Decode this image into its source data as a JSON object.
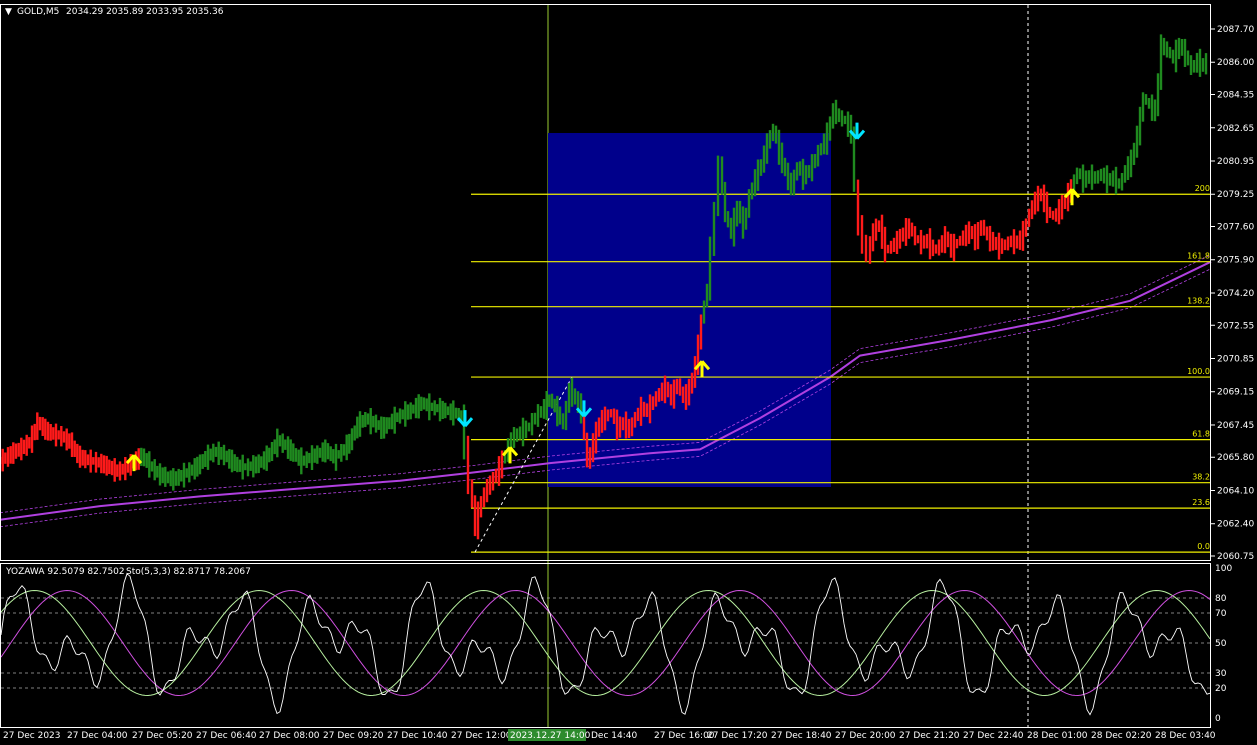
{
  "header": {
    "symbol": "GOLD,M5",
    "ohlc": "2034.29 2035.89 2033.95 2035.36"
  },
  "indicator_header": {
    "yozawa": "YOZAWA 92.5079 82.7502",
    "stoch": "Sto(5,3,3) 82.8717 78.2067"
  },
  "colors": {
    "background": "#000000",
    "bull": "#1f8a1f",
    "bear": "#ff1a1a",
    "fib_line": "#f0f000",
    "box": "#00008b",
    "ma": "#b040e0",
    "cursor_line": "#9acd32",
    "up_arrow": "#ffff00",
    "down_arrow": "#00e5ff"
  },
  "chart_data": {
    "type": "candlestick",
    "price_axis_labels": [
      "2087.70",
      "2086.00",
      "2084.35",
      "2082.65",
      "2080.95",
      "2079.25",
      "2077.60",
      "2075.90",
      "2074.20",
      "2072.55",
      "2070.85",
      "2069.15",
      "2067.45",
      "2065.80",
      "2064.10",
      "2062.40",
      "2060.75"
    ],
    "ylim": [
      2060.75,
      2087.7
    ],
    "time_axis_labels": [
      "27 Dec 2023",
      "27 Dec 04:00",
      "27 Dec 05:20",
      "27 Dec 06:40",
      "27 Dec 08:00",
      "27 Dec 09:20",
      "27 Dec 10:40",
      "27 Dec 12:00",
      "2023.12.27 14:00",
      "Dec 14:40",
      "27 Dec 16:00",
      "27 Dec 17:20",
      "27 Dec 18:40",
      "27 Dec 20:00",
      "27 Dec 21:20",
      "27 Dec 22:40",
      "28 Dec 01:00",
      "28 Dec 02:20",
      "28 Dec 03:40"
    ],
    "close_path": [
      [
        0,
        2065.6
      ],
      [
        8,
        2065.8
      ],
      [
        16,
        2066.1
      ],
      [
        24,
        2066.3
      ],
      [
        32,
        2066.6
      ],
      [
        40,
        2067.6
      ],
      [
        48,
        2067.2
      ],
      [
        56,
        2067.0
      ],
      [
        64,
        2066.9
      ],
      [
        72,
        2066.6
      ],
      [
        80,
        2065.9
      ],
      [
        88,
        2065.7
      ],
      [
        96,
        2065.6
      ],
      [
        104,
        2065.5
      ],
      [
        112,
        2065.3
      ],
      [
        120,
        2065.1
      ],
      [
        128,
        2065.3
      ],
      [
        136,
        2065.6
      ],
      [
        144,
        2065.9
      ],
      [
        152,
        2065.4
      ],
      [
        160,
        2065.0
      ],
      [
        168,
        2064.8
      ],
      [
        176,
        2064.7
      ],
      [
        184,
        2064.9
      ],
      [
        192,
        2065.1
      ],
      [
        200,
        2065.4
      ],
      [
        208,
        2065.8
      ],
      [
        216,
        2066.1
      ],
      [
        224,
        2066.0
      ],
      [
        232,
        2065.7
      ],
      [
        240,
        2065.4
      ],
      [
        248,
        2065.3
      ],
      [
        256,
        2065.4
      ],
      [
        264,
        2065.6
      ],
      [
        272,
        2066.0
      ],
      [
        280,
        2066.7
      ],
      [
        288,
        2066.4
      ],
      [
        296,
        2066.0
      ],
      [
        304,
        2065.6
      ],
      [
        312,
        2065.8
      ],
      [
        320,
        2066.0
      ],
      [
        328,
        2066.2
      ],
      [
        336,
        2065.8
      ],
      [
        344,
        2066.1
      ],
      [
        352,
        2066.6
      ],
      [
        360,
        2067.5
      ],
      [
        368,
        2067.8
      ],
      [
        376,
        2067.6
      ],
      [
        384,
        2067.3
      ],
      [
        392,
        2067.6
      ],
      [
        400,
        2067.9
      ],
      [
        408,
        2068.1
      ],
      [
        416,
        2068.3
      ],
      [
        424,
        2068.6
      ],
      [
        432,
        2068.4
      ],
      [
        440,
        2068.3
      ],
      [
        448,
        2068.2
      ],
      [
        456,
        2068.1
      ],
      [
        464,
        2067.9
      ],
      [
        468,
        2066.4
      ],
      [
        472,
        2064.5
      ],
      [
        478,
        2062.3
      ],
      [
        484,
        2063.6
      ],
      [
        490,
        2064.3
      ],
      [
        496,
        2064.7
      ],
      [
        502,
        2065.3
      ],
      [
        508,
        2066.0
      ],
      [
        514,
        2066.8
      ],
      [
        520,
        2067.0
      ],
      [
        526,
        2067.2
      ],
      [
        532,
        2067.4
      ],
      [
        538,
        2067.9
      ],
      [
        544,
        2068.2
      ],
      [
        552,
        2068.8
      ],
      [
        560,
        2068.1
      ],
      [
        566,
        2067.5
      ],
      [
        572,
        2069.3
      ],
      [
        578,
        2068.8
      ],
      [
        584,
        2068.2
      ],
      [
        590,
        2065.5
      ],
      [
        596,
        2066.6
      ],
      [
        602,
        2067.6
      ],
      [
        608,
        2067.9
      ],
      [
        614,
        2068.1
      ],
      [
        620,
        2067.3
      ],
      [
        626,
        2067.6
      ],
      [
        632,
        2067.2
      ],
      [
        638,
        2067.9
      ],
      [
        644,
        2068.3
      ],
      [
        650,
        2068.2
      ],
      [
        656,
        2068.7
      ],
      [
        662,
        2069.1
      ],
      [
        668,
        2069.4
      ],
      [
        674,
        2068.9
      ],
      [
        680,
        2069.6
      ],
      [
        686,
        2068.8
      ],
      [
        692,
        2069.3
      ],
      [
        698,
        2070.5
      ],
      [
        704,
        2072.8
      ],
      [
        710,
        2074.5
      ],
      [
        714,
        2076.5
      ],
      [
        718,
        2078.5
      ],
      [
        722,
        2080.9
      ],
      [
        728,
        2078.2
      ],
      [
        734,
        2077.3
      ],
      [
        740,
        2078.6
      ],
      [
        746,
        2077.6
      ],
      [
        752,
        2079.2
      ],
      [
        758,
        2080.1
      ],
      [
        764,
        2080.8
      ],
      [
        770,
        2081.9
      ],
      [
        776,
        2082.6
      ],
      [
        782,
        2081.4
      ],
      [
        788,
        2080.4
      ],
      [
        794,
        2079.6
      ],
      [
        800,
        2080.7
      ],
      [
        806,
        2080.2
      ],
      [
        812,
        2080.5
      ],
      [
        818,
        2081.1
      ],
      [
        824,
        2081.7
      ],
      [
        830,
        2082.3
      ],
      [
        836,
        2083.6
      ],
      [
        842,
        2083.2
      ],
      [
        848,
        2083.0
      ],
      [
        854,
        2082.5
      ],
      [
        858,
        2079.6
      ],
      [
        862,
        2077.6
      ],
      [
        866,
        2076.9
      ],
      [
        870,
        2076.1
      ],
      [
        876,
        2077.4
      ],
      [
        882,
        2077.7
      ],
      [
        888,
        2076.4
      ],
      [
        894,
        2076.6
      ],
      [
        900,
        2076.9
      ],
      [
        906,
        2077.3
      ],
      [
        912,
        2077.6
      ],
      [
        918,
        2077.0
      ],
      [
        924,
        2076.8
      ],
      [
        930,
        2076.9
      ],
      [
        936,
        2076.4
      ],
      [
        942,
        2076.6
      ],
      [
        948,
        2077.1
      ],
      [
        954,
        2076.5
      ],
      [
        960,
        2076.8
      ],
      [
        966,
        2077.1
      ],
      [
        972,
        2077.4
      ],
      [
        978,
        2077.0
      ],
      [
        984,
        2077.7
      ],
      [
        990,
        2077.1
      ],
      [
        996,
        2076.8
      ],
      [
        1002,
        2076.6
      ],
      [
        1008,
        2076.7
      ],
      [
        1014,
        2076.9
      ],
      [
        1020,
        2076.8
      ],
      [
        1026,
        2077.3
      ],
      [
        1032,
        2078.3
      ],
      [
        1038,
        2079.0
      ],
      [
        1044,
        2079.3
      ],
      [
        1050,
        2078.4
      ],
      [
        1056,
        2078.1
      ],
      [
        1062,
        2078.5
      ],
      [
        1068,
        2079.0
      ],
      [
        1074,
        2079.6
      ],
      [
        1080,
        2080.4
      ],
      [
        1086,
        2080.0
      ],
      [
        1092,
        2080.2
      ],
      [
        1098,
        2080.1
      ],
      [
        1104,
        2080.3
      ],
      [
        1110,
        2080.0
      ],
      [
        1116,
        2080.1
      ],
      [
        1122,
        2079.7
      ],
      [
        1128,
        2080.5
      ],
      [
        1134,
        2081.0
      ],
      [
        1140,
        2082.3
      ],
      [
        1146,
        2084.2
      ],
      [
        1152,
        2083.8
      ],
      [
        1158,
        2083.5
      ],
      [
        1164,
        2086.9
      ],
      [
        1170,
        2086.6
      ],
      [
        1176,
        2086.2
      ],
      [
        1182,
        2086.9
      ],
      [
        1188,
        2086.4
      ],
      [
        1194,
        2085.7
      ],
      [
        1200,
        2086.1
      ],
      [
        1206,
        2085.8
      ],
      [
        1210,
        2086.1
      ]
    ],
    "fib_levels": [
      {
        "label": "200",
        "price": 2079.25
      },
      {
        "label": "161.8",
        "price": 2075.8
      },
      {
        "label": "138.2",
        "price": 2073.5
      },
      {
        "label": "100.0",
        "price": 2069.9
      },
      {
        "label": "61.8",
        "price": 2066.7
      },
      {
        "label": "38.2",
        "price": 2064.5
      },
      {
        "label": "23.6",
        "price": 2063.2
      },
      {
        "label": "0.0",
        "price": 2060.95
      }
    ],
    "stoch_axis_labels": [
      "100",
      "80",
      "70",
      "50",
      "30",
      "20",
      "0"
    ],
    "stoch_ylim": [
      0,
      100
    ]
  },
  "arrows": {
    "up": [
      {
        "x": 134,
        "price": 2065.6
      },
      {
        "x": 510,
        "price": 2066.0
      },
      {
        "x": 702,
        "price": 2070.4
      },
      {
        "x": 1072,
        "price": 2079.2
      }
    ],
    "down": [
      {
        "x": 465,
        "price": 2067.7
      },
      {
        "x": 584,
        "price": 2068.2
      },
      {
        "x": 857,
        "price": 2082.4
      }
    ]
  }
}
